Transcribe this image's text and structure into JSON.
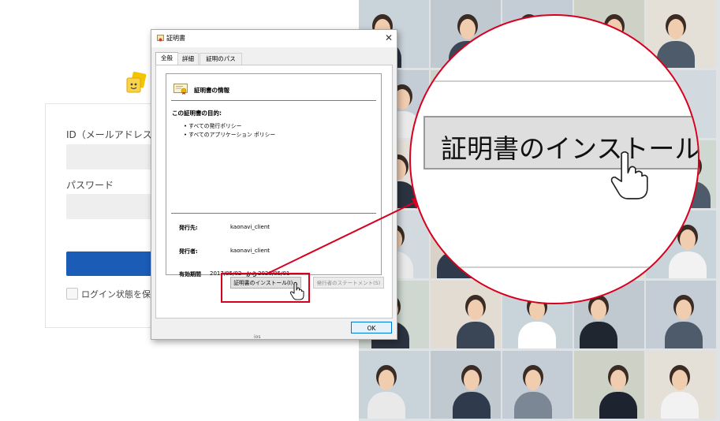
{
  "login": {
    "id_label": "ID（メールアドレス）",
    "password_label": "パスワード",
    "remember_label": "ログイン状態を保持す"
  },
  "dialog": {
    "title": "証明書",
    "close_glyph": "✕",
    "tabs": [
      {
        "label": "全般",
        "active": true
      },
      {
        "label": "詳細",
        "active": false
      },
      {
        "label": "証明のパス",
        "active": false
      }
    ],
    "info_header": "証明書の情報",
    "purpose_header": "この証明書の目的:",
    "purposes": [
      "• すべての発行ポリシー",
      "• すべてのアプリケーション ポリシー"
    ],
    "issued_to_label": "発行先:",
    "issued_to_value": "kaonavi_client",
    "issued_by_label": "発行者:",
    "issued_by_value": "kaonavi_client",
    "validity_label": "有効期間",
    "valid_from": "2017/05/02",
    "valid_from_word": "から",
    "valid_to": "2020/05/01",
    "install_button": "証明書のインストール(I)...",
    "issuer_statement_button": "発行者のステートメント(S)",
    "ok_button": "OK",
    "bottom_text": "ios"
  },
  "magnifier": {
    "zoomed_label": "証明書のインストール(I)..."
  },
  "icons": {
    "logo": "kaonavi-logo-icon",
    "title": "certificate-small-icon",
    "cert": "certificate-icon",
    "cursor": "hand-pointer-icon"
  },
  "colors": {
    "accent_red": "#d7001f",
    "login_blue": "#1b5cb6",
    "ok_border": "#0078d7",
    "logo_yellow": "#f5c400"
  }
}
